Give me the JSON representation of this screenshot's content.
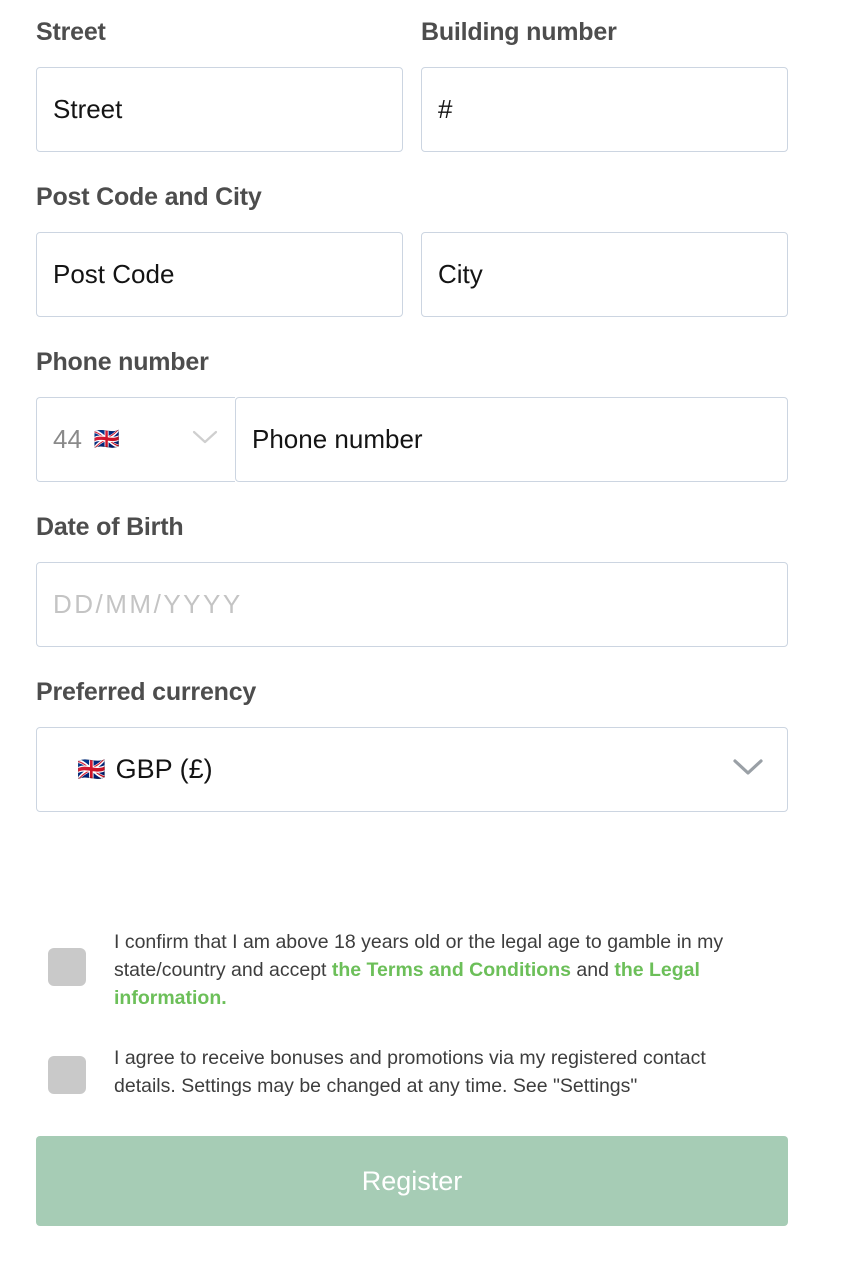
{
  "form": {
    "street": {
      "label": "Street",
      "value": "Street"
    },
    "building_number": {
      "label": "Building number",
      "value": "#"
    },
    "post_code_and_city": {
      "label": "Post Code and City",
      "post_code_value": "Post Code",
      "city_value": "City"
    },
    "phone": {
      "label": "Phone number",
      "country_code": "44",
      "country_flag": "🇬🇧",
      "input_value": "Phone number",
      "chevron_icon": "chevron-down-icon"
    },
    "date_of_birth": {
      "label": "Date of Birth",
      "placeholder": "DD/MM/YYYY"
    },
    "currency": {
      "label": "Preferred currency",
      "selected_flag": "🇬🇧",
      "selected_value": "GBP (£)",
      "chevron_icon": "chevron-down-icon"
    }
  },
  "consent": {
    "age_terms": {
      "text_part1": "I confirm that I am above 18 years old or the legal age to gamble in my state/country and accept ",
      "link1": "the Terms and Conditions",
      "text_part2": " and ",
      "link2": "the Legal information.",
      "checked": false
    },
    "marketing": {
      "text": "I agree to receive bonuses and promotions via my registered contact details. Settings may be changed at any time. See \"Settings\"",
      "checked": false
    }
  },
  "submit": {
    "register_label": "Register"
  },
  "colors": {
    "link_green": "#6cbf59",
    "button_green": "#a6ccb5",
    "input_border": "#ccd5e1",
    "label_text": "#4d4d4d",
    "checkbox_gray": "#c9c9c9",
    "placeholder_gray": "#c4c4c4"
  }
}
